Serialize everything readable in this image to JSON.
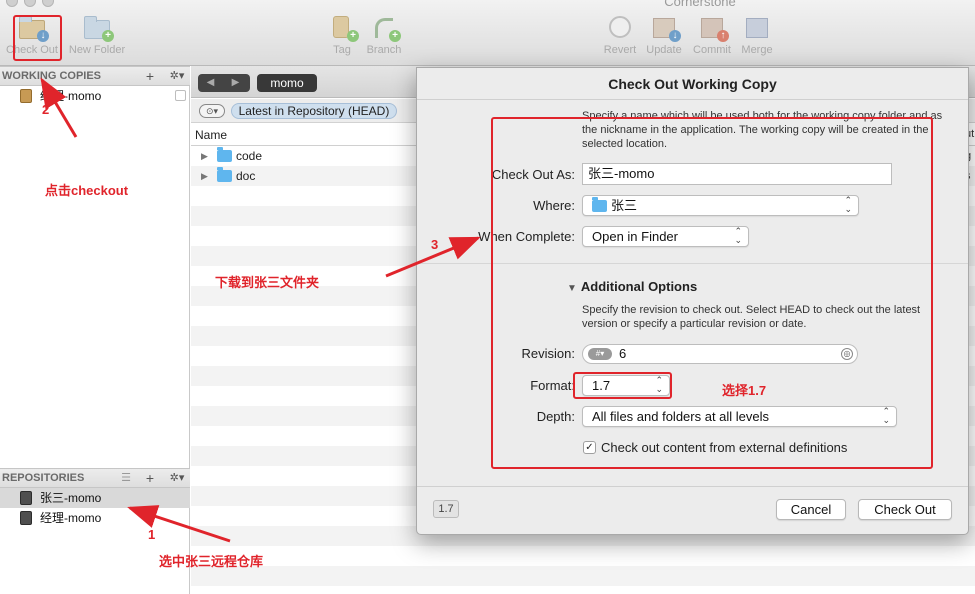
{
  "window": {
    "title": "Cornerstone"
  },
  "toolbar": {
    "checkout": "Check Out",
    "new_folder": "New Folder",
    "tag": "Tag",
    "branch": "Branch",
    "revert": "Revert",
    "update": "Update",
    "commit": "Commit",
    "merge": "Merge"
  },
  "sidebar": {
    "working_copies_header": "WORKING COPIES",
    "working_copies": [
      {
        "label": "经理-momo"
      }
    ],
    "repositories_header": "REPOSITORIES",
    "repositories": [
      {
        "label": "张三-momo",
        "selected": true
      },
      {
        "label": "经理-momo",
        "selected": false
      }
    ],
    "add_symbol": "+",
    "gear_symbol": "✲▾",
    "list_symbol": "☰"
  },
  "browser": {
    "path": "momo",
    "nav_back": "◀",
    "nav_forward": "▶",
    "revision_toggle": "⊙▾",
    "revision_filter": "Latest in Repository (HEAD)",
    "column_name": "Name",
    "rows": [
      {
        "name": "code",
        "disclosure": "▶"
      },
      {
        "name": "doc",
        "disclosure": "▶"
      }
    ],
    "right_edge_text": [
      "ut",
      "g",
      "s"
    ]
  },
  "dialog": {
    "title": "Check Out Working Copy",
    "intro": "Specify a name which will be used both for the working copy folder and as the nickname in the application. The working copy will be created in the selected location.",
    "checkout_as_label": "Check Out As:",
    "checkout_as_value": "张三-momo",
    "where_label": "Where:",
    "where_value": "张三",
    "when_complete_label": "When Complete:",
    "when_complete_value": "Open in Finder",
    "additional_options_title": "Additional Options",
    "additional_options_arrow": "▼",
    "additional_intro": "Specify the revision to check out. Select HEAD to check out the latest version or specify a particular revision or date.",
    "revision_label": "Revision:",
    "revision_value": "6",
    "revision_hash": "#▾",
    "format_label": "Format:",
    "format_value": "1.7",
    "depth_label": "Depth:",
    "depth_value": "All files and folders at all levels",
    "external_defs_label": "Check out content from external definitions",
    "external_defs_checked": true,
    "version_badge": "1.7",
    "cancel_label": "Cancel",
    "checkout_label": "Check Out"
  },
  "annotations": {
    "step1_number": "1",
    "step1_text": "选中张三远程仓库",
    "step2_number": "2",
    "step2_text": "点击checkout",
    "step3_number": "3",
    "step3_text": "下载到张三文件夹",
    "format_text": "选择1.7",
    "color": "#e0242b"
  }
}
